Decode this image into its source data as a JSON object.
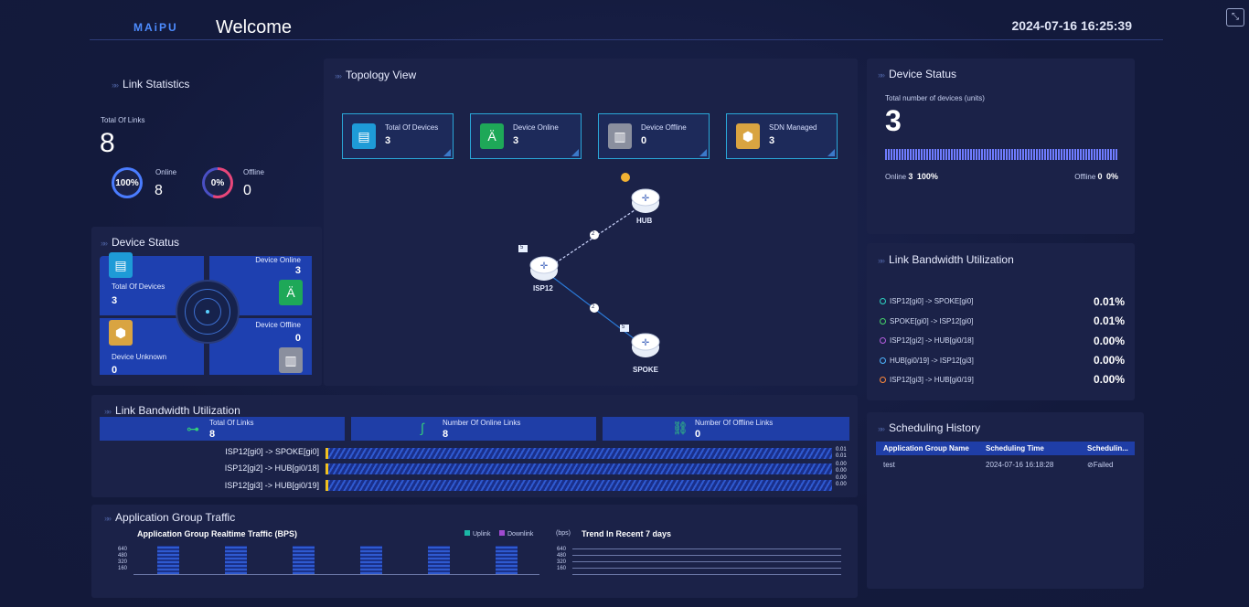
{
  "header": {
    "logo": "MAiPU",
    "title": "Welcome",
    "datetime": "2024-07-16 16:25:39"
  },
  "link_statistics": {
    "title": "Link Statistics",
    "total_label": "Total Of Links",
    "total_value": "8",
    "online_label": "Online",
    "online_pct": "100%",
    "online_value": "8",
    "offline_label": "Offline",
    "offline_pct": "0%",
    "offline_value": "0",
    "colors": {
      "online_ring": "#4a7cff",
      "offline_ring": "#e8467a"
    }
  },
  "device_status_left": {
    "title": "Device Status",
    "total_label": "Total Of Devices",
    "total_value": "3",
    "online_label": "Device Online",
    "online_value": "3",
    "unknown_label": "Device Unknown",
    "unknown_value": "0",
    "offline_label": "Device Offline",
    "offline_value": "0"
  },
  "topology": {
    "title": "Topology View",
    "cards": [
      {
        "label": "Total Of Devices",
        "value": "3",
        "icon": "server-icon",
        "color": "#1e9bd7"
      },
      {
        "label": "Device Online",
        "value": "3",
        "icon": "antenna-icon",
        "color": "#1ea858"
      },
      {
        "label": "Device Offline",
        "value": "0",
        "icon": "router-offline-icon",
        "color": "#8a8f9e"
      },
      {
        "label": "SDN Managed",
        "value": "3",
        "icon": "cube-icon",
        "color": "#d9a441"
      }
    ],
    "nodes": {
      "hub": "HUB",
      "isp": "ISP12",
      "spoke": "SPOKE"
    },
    "link_labels": {
      "hub_link": "2",
      "spoke_link": "2"
    },
    "badges": {
      "isp": "5",
      "spoke": "5"
    }
  },
  "device_status_right": {
    "title": "Device Status",
    "subtitle": "Total number of devices (units)",
    "total": "3",
    "online_label": "Online",
    "online_count": "3",
    "online_pct": "100%",
    "offline_label": "Offline",
    "offline_count": "0",
    "offline_pct": "0%",
    "online_fraction": 1.0
  },
  "link_bw_right": {
    "title": "Link Bandwidth Utilization",
    "rows": [
      {
        "label": "ISP12[gi0] -> SPOKE[gi0]",
        "pct": "0.01%",
        "color": "#2ed3c2"
      },
      {
        "label": "SPOKE[gi0] -> ISP12[gi0]",
        "pct": "0.01%",
        "color": "#45d36b"
      },
      {
        "label": "ISP12[gi2] -> HUB[gi0/18]",
        "pct": "0.00%",
        "color": "#b55ee0"
      },
      {
        "label": "HUB[gi0/19] -> ISP12[gi3]",
        "pct": "0.00%",
        "color": "#4fb6ff"
      },
      {
        "label": "ISP12[gi3] -> HUB[gi0/19]",
        "pct": "0.00%",
        "color": "#ff8a3c"
      }
    ]
  },
  "link_bw_bottom": {
    "title": "Link Bandwidth Utilization",
    "total_label": "Total Of Links",
    "total_value": "8",
    "online_label": "Number Of Online Links",
    "online_value": "8",
    "offline_label": "Number Of Offline Links",
    "offline_value": "0",
    "rows": [
      {
        "label": "ISP12[gi0] -> SPOKE[gi0]",
        "values": [
          "0.01",
          "0.01"
        ]
      },
      {
        "label": "ISP12[gi2] -> HUB[gi0/18]",
        "values": [
          "0.00",
          "0.00"
        ]
      },
      {
        "label": "ISP12[gi3] -> HUB[gi0/19]",
        "values": [
          "0.00",
          "0.00"
        ]
      }
    ]
  },
  "scheduling": {
    "title": "Scheduling History",
    "columns": [
      "Application Group Name",
      "Scheduling Time",
      "Schedulin..."
    ],
    "rows": [
      {
        "name": "test",
        "time": "2024-07-16 16:18:28",
        "status": "Failed"
      }
    ]
  },
  "app_traffic": {
    "title": "Application Group Traffic",
    "realtime_title": "Application Group Realtime Traffic (BPS)",
    "legend_uplink": "Uplink",
    "legend_downlink": "Downlink",
    "unit": "(bps)",
    "trend_title": "Trend In Recent 7 days",
    "yticks": [
      "640",
      "480",
      "320",
      "160"
    ],
    "colors": {
      "uplink": "#1bb7a6",
      "downlink": "#a04ad0"
    }
  }
}
